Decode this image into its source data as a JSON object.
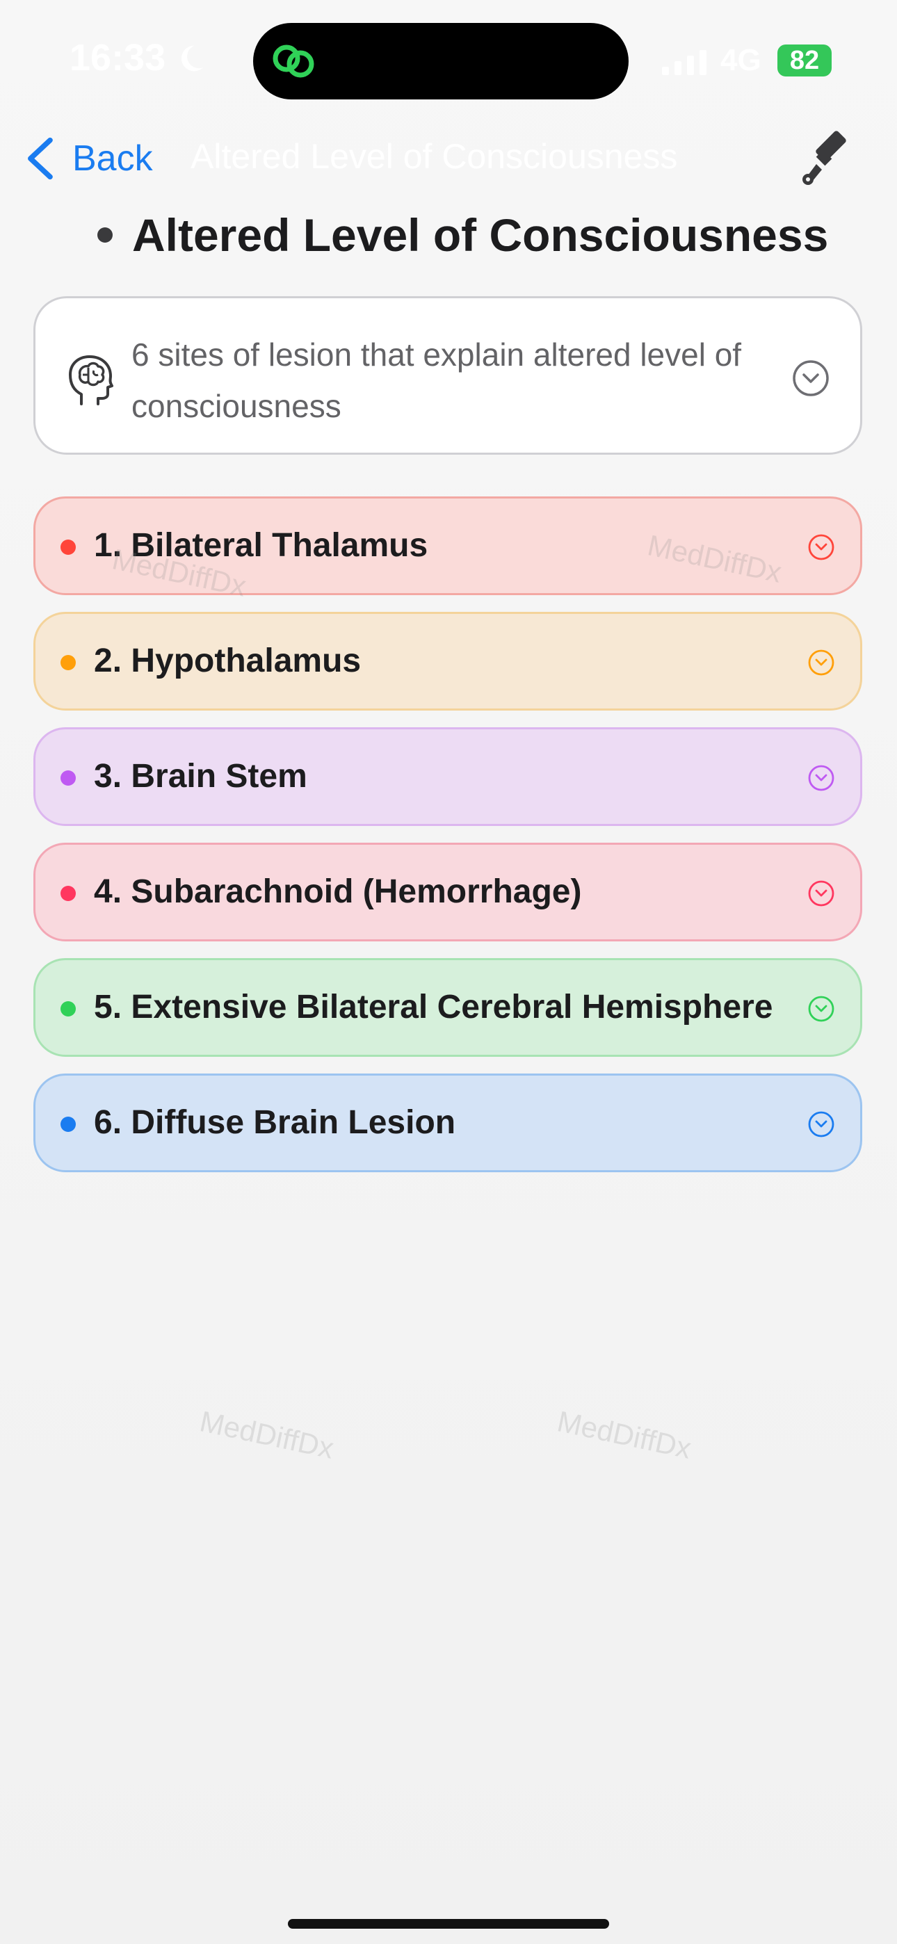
{
  "status_bar": {
    "time": "16:33",
    "network": "4G",
    "battery": "82"
  },
  "nav": {
    "back_label": "Back",
    "title": "Altered Level of Consciousness"
  },
  "page": {
    "title": "Altered Level of Consciousness"
  },
  "summary": {
    "text": "6 sites of lesion that explain altered level of consciousness"
  },
  "items": [
    {
      "label": "1. Bilateral Thalamus",
      "accent": "#ff453a",
      "bg": "#fadbd9",
      "border": "#f3a8a3"
    },
    {
      "label": "2. Hypothalamus",
      "accent": "#ff9f0a",
      "bg": "#f7e8d4",
      "border": "#f4d39a"
    },
    {
      "label": "3. Brain Stem",
      "accent": "#bf5af2",
      "bg": "#eddcf4",
      "border": "#dcb6ef"
    },
    {
      "label": "4. Subarachnoid (Hemorrhage)",
      "accent": "#ff375f",
      "bg": "#f9d9de",
      "border": "#f3a7b5"
    },
    {
      "label": "5. Extensive Bilateral Cerebral Hemisphere",
      "accent": "#30d158",
      "bg": "#d6f0db",
      "border": "#a8e3b3"
    },
    {
      "label": "6. Diffuse Brain Lesion",
      "accent": "#1a7cf0",
      "bg": "#d4e3f6",
      "border": "#9cc4f0"
    }
  ],
  "watermark": "MedDiffDx",
  "icons": {
    "back": "chevron-left-icon",
    "tool": "paintbrush-icon",
    "brain": "brain-head-icon",
    "chevron": "chevron-down-circle-icon",
    "moon": "moon-icon",
    "signal": "signal-bars-icon"
  }
}
